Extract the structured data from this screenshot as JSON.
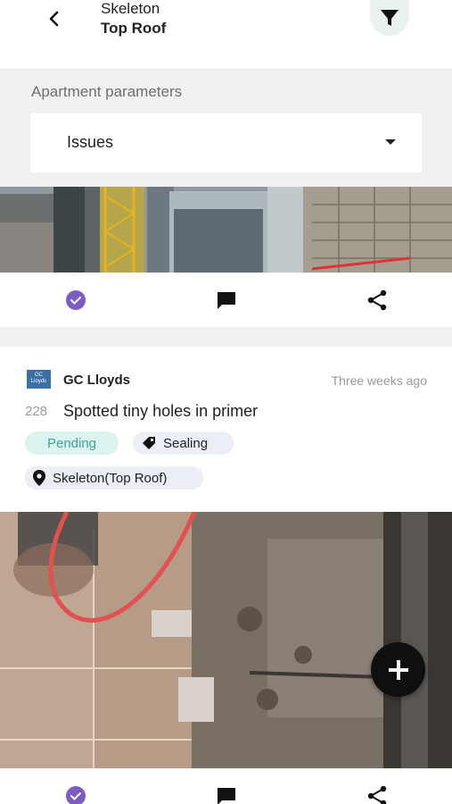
{
  "header": {
    "subtitle": "Skeleton",
    "title": "Top Roof",
    "back_icon": "chevron-left-icon",
    "filter_icon": "filter-icon"
  },
  "params": {
    "label": "Apartment parameters",
    "selected": "Issues",
    "caret_icon": "caret-down-icon"
  },
  "first_post": {
    "actions": [
      "check-circle-icon",
      "comment-icon",
      "share-icon"
    ]
  },
  "issue": {
    "company": "GC Lloyds",
    "logo_text": "GC Lloyds",
    "timestamp": "Three weeks ago",
    "number": "228",
    "title": "Spotted tiny holes in primer",
    "status": "Pending",
    "tag": "Sealing",
    "location": "Skeleton(Top Roof)",
    "actions": [
      "check-circle-icon",
      "comment-icon",
      "share-icon"
    ]
  },
  "fab": {
    "icon": "plus-icon"
  },
  "colors": {
    "accent_purple": "#7c5cc4",
    "status_teal": "#3aa59a",
    "status_bg": "#ddf3ef",
    "chip_bg": "#eceef6",
    "filter_bg": "#e9f2ec"
  }
}
